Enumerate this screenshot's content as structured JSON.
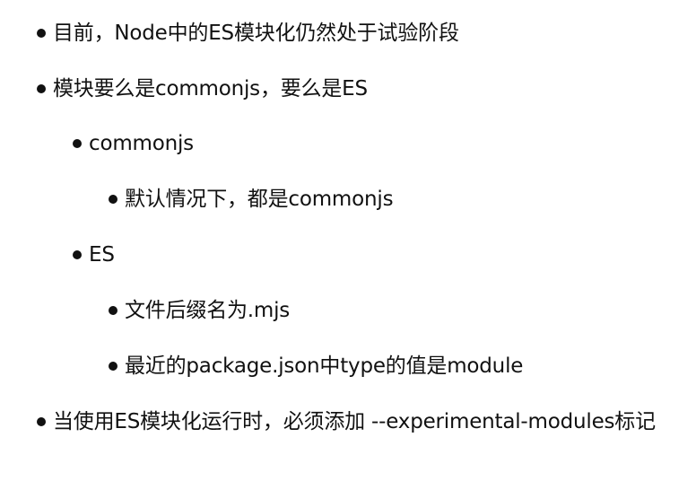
{
  "bullets": [
    {
      "text": "目前，Node中的ES模块化仍然处于试验阶段"
    },
    {
      "text": "模块要么是commonjs，要么是ES"
    },
    {
      "text": "commonjs"
    },
    {
      "text": "默认情况下，都是commonjs"
    },
    {
      "text": "ES"
    },
    {
      "text": "文件后缀名为.mjs"
    },
    {
      "text": "最近的package.json中type的值是module"
    },
    {
      "text": "当使用ES模块化运行时，必须添加 --experimental-modules标记"
    }
  ]
}
